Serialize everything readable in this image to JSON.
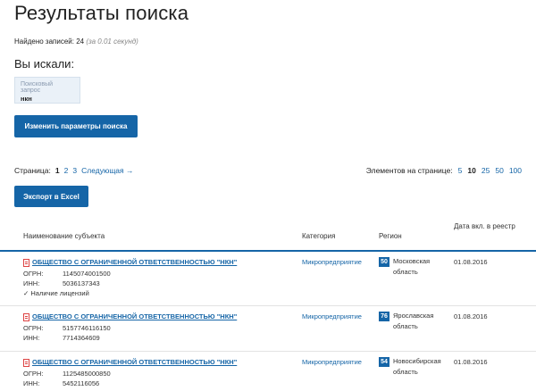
{
  "page_title": "Результаты поиска",
  "found": {
    "label": "Найдено записей:",
    "count": "24",
    "time": "(за 0.01 секунд)"
  },
  "searched": {
    "heading": "Вы искали:",
    "query_label": "Поисковый запрос",
    "query_value": "нкн"
  },
  "buttons": {
    "change_params": "Изменить параметры поиска",
    "export_excel": "Экспорт в Excel"
  },
  "pagination": {
    "label": "Страница:",
    "pages": [
      "1",
      "2",
      "3"
    ],
    "current": "1",
    "next": "Следующая →"
  },
  "per_page": {
    "label": "Элементов на странице:",
    "options": [
      "5",
      "10",
      "25",
      "50",
      "100"
    ],
    "current": "10"
  },
  "table": {
    "headers": {
      "name": "Наименование субъекта",
      "category": "Категория",
      "region": "Регион",
      "date": "Дата вкл. в реестр"
    },
    "ogrn_label": "ОГРН:",
    "inn_label": "ИНН:",
    "rows": [
      {
        "name": "ОБЩЕСТВО С ОГРАНИЧЕННОЙ ОТВЕТСТВЕННОСТЬЮ \"НКН\"",
        "ogrn": "1145074001500",
        "inn": "5036137343",
        "license": "✓ Наличие лицензий",
        "category": "Микропредприятие",
        "region_code": "50",
        "region_name": "Московская область",
        "date": "01.08.2016"
      },
      {
        "name": "ОБЩЕСТВО С ОГРАНИЧЕННОЙ ОТВЕТСТВЕННОСТЬЮ \"НКН\"",
        "ogrn": "5157746116150",
        "inn": "7714364609",
        "category": "Микропредприятие",
        "region_code": "76",
        "region_name": "Ярославская область",
        "date": "01.08.2016"
      },
      {
        "name": "ОБЩЕСТВО С ОГРАНИЧЕННОЙ ОТВЕТСТВЕННОСТЬЮ \"НКН\"",
        "ogrn": "1125485000850",
        "inn": "5452116056",
        "category": "Микропредприятие",
        "region_code": "54",
        "region_name": "Новосибирская область",
        "date": "01.08.2016"
      }
    ]
  },
  "icons": {
    "document": "document-icon"
  },
  "colors": {
    "accent": "#1565a7",
    "link": "#1565a7",
    "doc_icon": "#dd4444"
  }
}
